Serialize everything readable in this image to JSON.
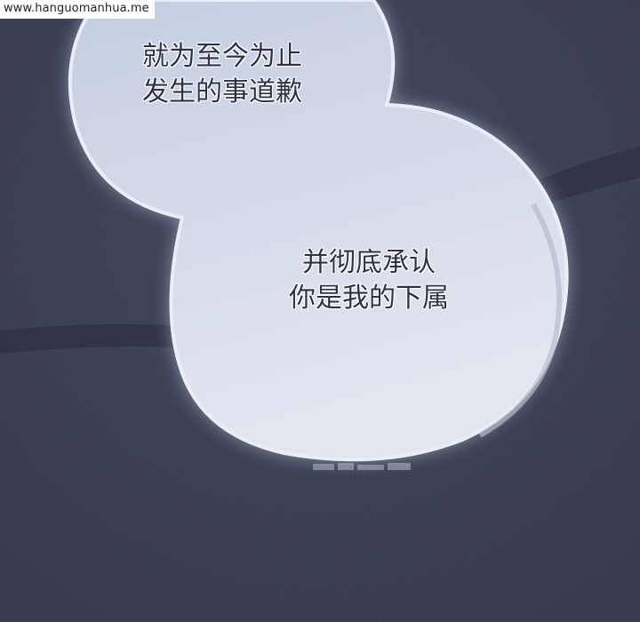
{
  "watermark": {
    "text": "www.hanguomanhua.me"
  },
  "bubble_top": {
    "line1": "就为至今为止",
    "line2": "发生的事道歉"
  },
  "bubble_bottom": {
    "line1": "并彻底承认",
    "line2": "你是我的下属"
  },
  "colors": {
    "background": "#33364d",
    "bubble": "#cdd5e6",
    "text": "#2e3148"
  }
}
